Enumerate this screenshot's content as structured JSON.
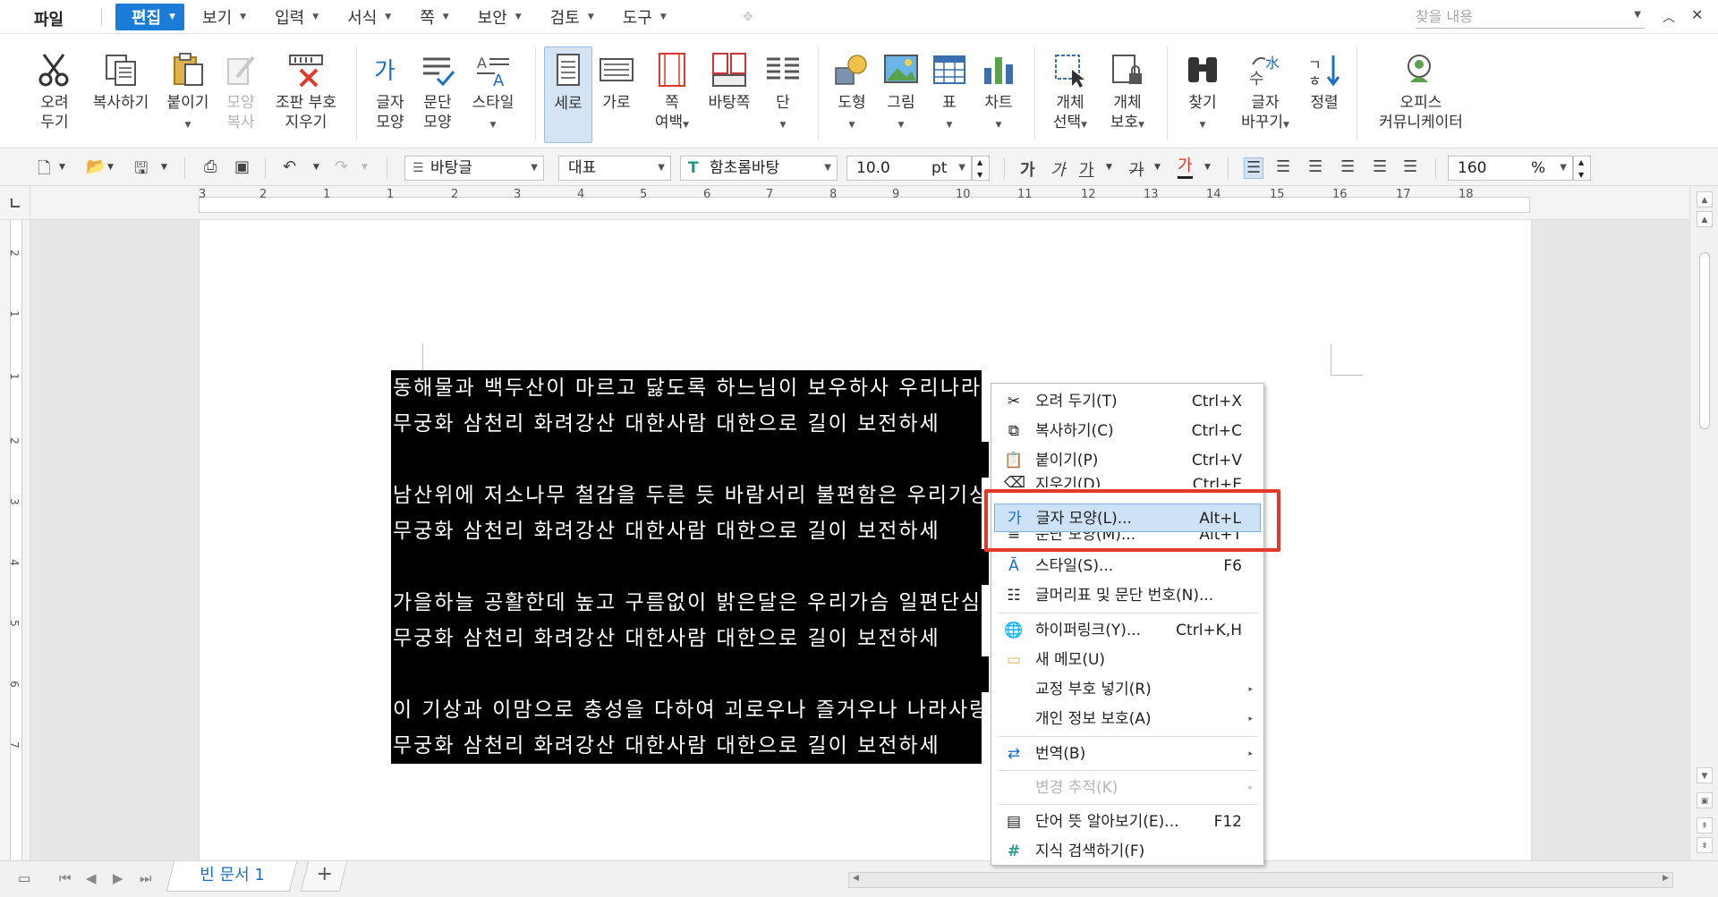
{
  "menubar": {
    "file": "파일",
    "items": [
      {
        "label": "편집"
      },
      {
        "label": "보기"
      },
      {
        "label": "입력"
      },
      {
        "label": "서식"
      },
      {
        "label": "쪽"
      },
      {
        "label": "보안"
      },
      {
        "label": "검토"
      },
      {
        "label": "도구"
      }
    ],
    "search_placeholder": "찾을 내용"
  },
  "ribbon": {
    "cut": [
      "오려",
      "두기"
    ],
    "copy": "복사하기",
    "paste": "붙이기",
    "format_copy": [
      "모양",
      "복사"
    ],
    "clear_marks": [
      "조판 부호",
      "지우기"
    ],
    "char_shape": [
      "글자",
      "모양"
    ],
    "para_shape": [
      "문단",
      "모양"
    ],
    "style": "스타일",
    "vertical": "세로",
    "horizontal": "가로",
    "page_margin": [
      "쪽",
      "여백"
    ],
    "background": "바탕쪽",
    "column": "단",
    "shape": "도형",
    "picture": "그림",
    "table": "표",
    "chart": "차트",
    "obj_select": [
      "개체",
      "선택"
    ],
    "obj_protect": [
      "개체",
      "보호"
    ],
    "find": "찾기",
    "replace": [
      "글자",
      "바꾸기"
    ],
    "sort": "정렬",
    "office_communicator": [
      "오피스",
      "커뮤니케이터"
    ]
  },
  "toolbar": {
    "style": "바탕글",
    "lang": "대표",
    "font": "함초롬바탕",
    "size": "10.0",
    "size_unit": "pt",
    "zoom": "160",
    "zoom_unit": "%"
  },
  "ruler": {
    "h_numbers": [
      "3",
      "2",
      "1",
      "1",
      "2",
      "3",
      "4",
      "5",
      "6",
      "7",
      "8",
      "9",
      "10",
      "11",
      "12",
      "13",
      "14",
      "15",
      "16",
      "17",
      "18"
    ],
    "v_numbers": [
      "2",
      "1",
      "1",
      "2",
      "3",
      "4",
      "5",
      "6",
      "7"
    ]
  },
  "document": {
    "lines": [
      "동해물과 백두산이 마르고 닳도록 하느님이 보우하사 우리나라 만세",
      "무궁화 삼천리 화려강산 대한사람 대한으로 길이 보전하세",
      "",
      "남산위에 저소나무 철갑을 두른 듯 바람서리 불편함은 우리기상일세",
      "무궁화 삼천리 화려강산 대한사람 대한으로 길이 보전하세",
      "",
      "가을하늘 공활한데 높고 구름없이 밝은달은 우리가슴 일편단심일세",
      "무궁화 삼천리 화려강산 대한사람 대한으로 길이 보전하세",
      "",
      "이 기상과 이맘으로 충성을 다하여 괴로우나 즐거우나 나라사랑하세",
      "무궁화 삼천리 화려강산 대한사람 대한으로 길이 보전하세"
    ]
  },
  "context_menu": {
    "items": [
      {
        "label": "오려 두기(T)",
        "shortcut": "Ctrl+X"
      },
      {
        "label": "복사하기(C)",
        "shortcut": "Ctrl+C"
      },
      {
        "label": "붙이기(P)",
        "shortcut": "Ctrl+V"
      },
      {
        "label": "지우기(D)",
        "shortcut": "Ctrl+E"
      },
      {
        "label": "글자 모양(L)...",
        "shortcut": "Alt+L"
      },
      {
        "label": "문단 모양(M)...",
        "shortcut": "Alt+T"
      },
      {
        "label": "스타일(S)...",
        "shortcut": "F6"
      },
      {
        "label": "글머리표 및 문단 번호(N)...",
        "shortcut": ""
      },
      {
        "label": "하이퍼링크(Y)...",
        "shortcut": "Ctrl+K,H"
      },
      {
        "label": "새 메모(U)",
        "shortcut": ""
      },
      {
        "label": "교정 부호 넣기(R)",
        "shortcut": ""
      },
      {
        "label": "개인 정보 보호(A)",
        "shortcut": ""
      },
      {
        "label": "번역(B)",
        "shortcut": ""
      },
      {
        "label": "변경 추적(K)",
        "shortcut": ""
      },
      {
        "label": "단어 뜻 알아보기(E)...",
        "shortcut": "F12"
      },
      {
        "label": "지식 검색하기(F)",
        "shortcut": ""
      }
    ]
  },
  "statusbar": {
    "doc_tab": "빈 문서 1",
    "add_tab": "+"
  },
  "colors": {
    "accent": "#1a7cd6",
    "highlight_box": "#e1392b",
    "menu_highlight": "#cde2f7"
  }
}
